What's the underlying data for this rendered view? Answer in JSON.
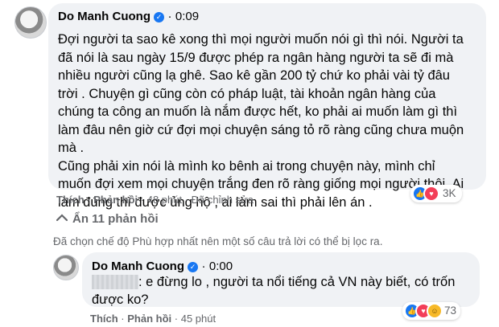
{
  "comment": {
    "author": "Do Manh Cuong",
    "timestamp": "0:09",
    "lines": [
      "Đợi người ta sao kê xong thì mọi người muốn nói gì thì nói. Người ta",
      "đã nói là sau ngày 15/9 được phép ra ngân hàng người ta sẽ đi mà",
      "nhiều người cũng lạ ghê. Sao kê gần 200 tỷ chứ ko phải vài tỷ đâu",
      "trời . Chuyện gì cũng còn có pháp luật, tài khoản ngân hàng của",
      "chúng ta công an muốn là nắm được hết, ko phải ai muốn làm gì thì",
      "làm đâu nên giờ cứ đợi mọi chuyện sáng tỏ rõ ràng cũng chưa muộn",
      "mà .",
      "Cũng phải xin nói là mình ko bênh ai trong chuyện này, mình chỉ",
      "muốn đợi xem mọi chuyện trắng đen rõ ràng giống mọi người thôi. Ai",
      "làm đúng thì được ủng hộ , ai làm sai thì phải lên án ."
    ],
    "actions": {
      "like": "Thích",
      "reply": "Phản hồi",
      "age": "48 phút",
      "edited": "Đã chỉnh sửa"
    },
    "reaction_count": "3K"
  },
  "hidden_replies": {
    "label": "Ẩn 11 phản hồi"
  },
  "filter_notice": "Đã chọn chế độ Phù hợp nhất nên một số câu trả lời có thể bị lọc ra.",
  "reply": {
    "author": "Do Manh Cuong",
    "timestamp": "0:00",
    "lines": [
      ": e đừng lo , người ta nổi tiếng cả VN này biết, có trốn",
      "được ko?"
    ],
    "actions": {
      "like": "Thích",
      "reply": "Phản hồi",
      "age": "45 phút"
    },
    "reaction_count": "73"
  },
  "icons": {
    "verified": "verified-badge-icon",
    "chevron": "chevron-up-icon",
    "like": "like-reaction-icon",
    "love": "love-reaction-icon",
    "haha": "haha-reaction-icon"
  },
  "colors": {
    "bubble": "#f0f2f5",
    "meta_text": "#65676b",
    "like_blue": "#1877f2",
    "love_red": "#f33e58",
    "haha_yellow": "#f7b928"
  }
}
